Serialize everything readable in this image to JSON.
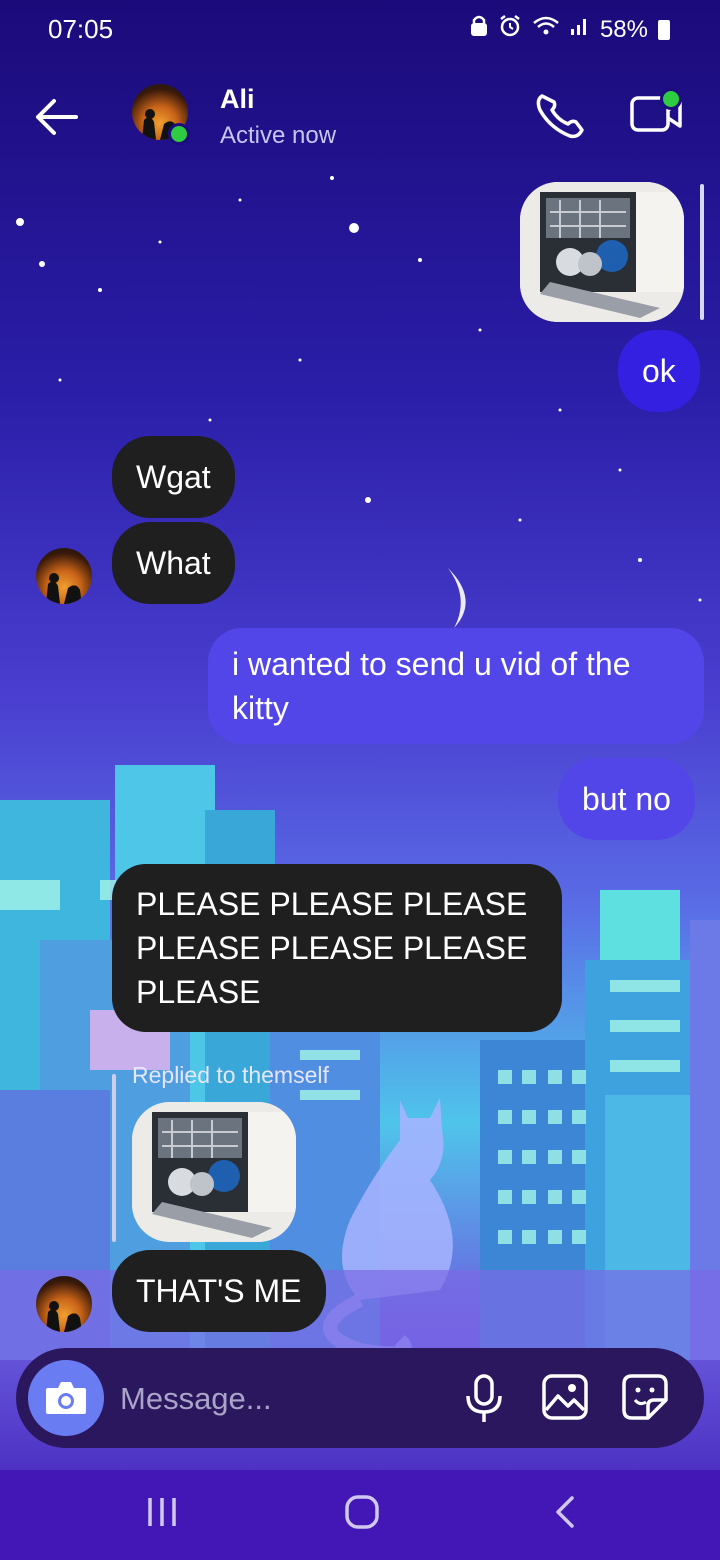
{
  "status_bar": {
    "time": "07:05",
    "battery": "58%"
  },
  "header": {
    "contact_name": "Ali",
    "contact_status": "Active now"
  },
  "messages": [
    {
      "sender": "me",
      "type": "image",
      "description_icon": "dishwasher-photo"
    },
    {
      "sender": "me",
      "type": "text",
      "text": "ok"
    },
    {
      "sender": "them",
      "type": "text",
      "text": "Wgat"
    },
    {
      "sender": "them",
      "type": "text",
      "text": "What"
    },
    {
      "sender": "me",
      "type": "text",
      "text": "i wanted to send u vid of the kitty"
    },
    {
      "sender": "me",
      "type": "text",
      "text": "but no"
    },
    {
      "sender": "them",
      "type": "text",
      "text": "PLEASE PLEASE PLEASE PLEASE PLEASE PLEASE PLEASE"
    },
    {
      "sender": "them",
      "type": "reply",
      "reply_label": "Replied to themself",
      "text": "THAT'S ME"
    }
  ],
  "composer": {
    "placeholder": "Message..."
  },
  "colors": {
    "received_bubble": "#1f1f1f",
    "sent_bubble": "#5346e8",
    "online": "#2ecc40"
  }
}
